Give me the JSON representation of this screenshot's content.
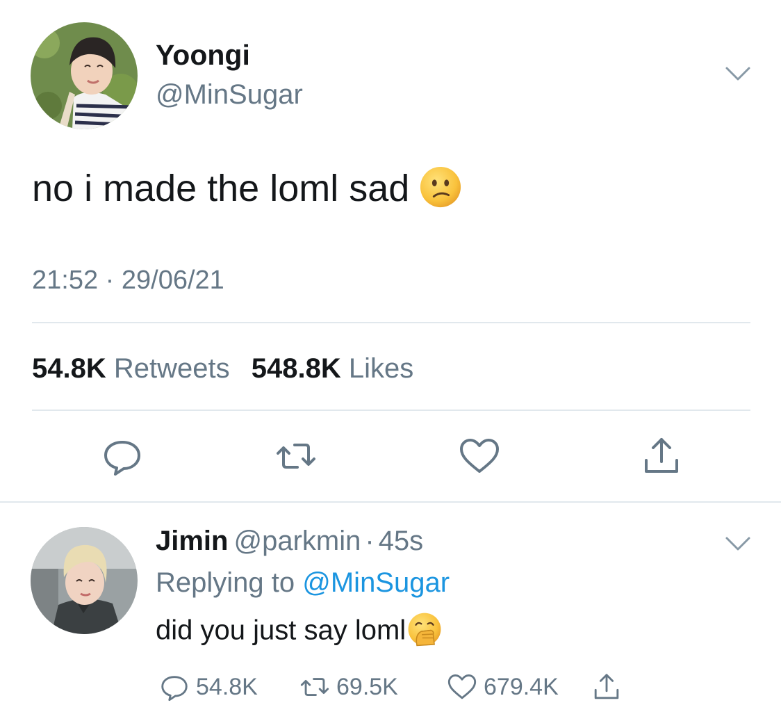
{
  "main_tweet": {
    "author_name": "Yoongi",
    "author_handle": "@MinSugar",
    "text": "no i made the loml sad",
    "emoji": "confused-face-emoji",
    "timestamp": "21:52 · 29/06/21",
    "retweets_count": "54.8K",
    "retweets_label": "Retweets",
    "likes_count": "548.8K",
    "likes_label": "Likes",
    "actions": [
      "reply-icon",
      "retweet-icon",
      "like-icon",
      "share-icon"
    ]
  },
  "reply_tweet": {
    "author_name": "Jimin",
    "author_handle": "@parkmin",
    "separator": "·",
    "time": "45s",
    "replying_prefix": "Replying to",
    "replying_to": "@MinSugar",
    "text": "did you just say loml",
    "emoji": "hand-over-mouth-emoji",
    "reply_count": "54.8K",
    "retweet_count": "69.5K",
    "like_count": "679.4K"
  },
  "colors": {
    "text_primary": "#14171a",
    "text_secondary": "#657786",
    "link": "#1b95e0",
    "divider": "#e1e8ed"
  }
}
